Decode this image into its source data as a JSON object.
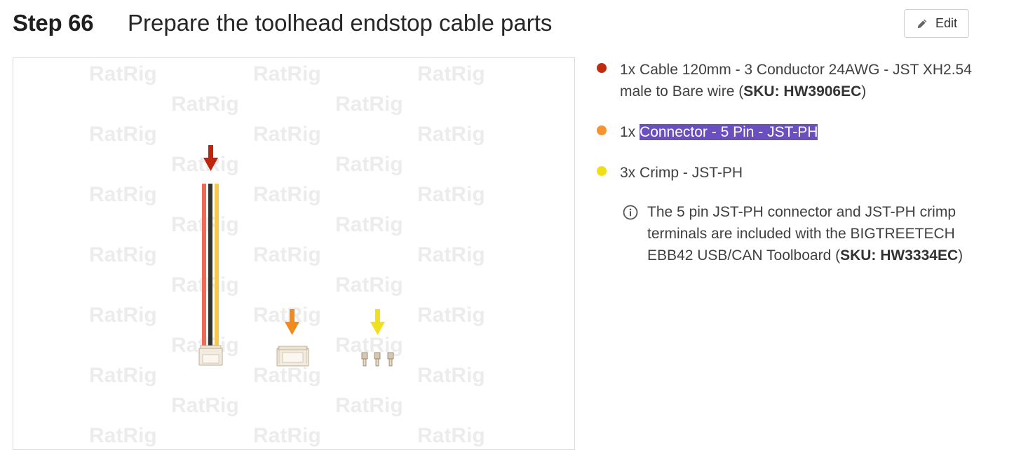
{
  "header": {
    "step_label": "Step 66",
    "title": "Prepare the toolhead endstop cable parts",
    "edit_label": "Edit"
  },
  "image": {
    "watermark": "RatRig",
    "arrow_colors": [
      "#c0240e",
      "#f28a1c",
      "#f0e020"
    ],
    "wire_colors": [
      "#ef6a55",
      "#333333",
      "#f8c84b"
    ]
  },
  "bullets": [
    {
      "color": "#c22a10",
      "qty": "1x",
      "text": "Cable 120mm - 3 Conductor 24AWG - JST XH2.54 male to Bare wire (",
      "sku": "SKU: HW3906EC",
      "suffix": ")"
    },
    {
      "color": "#f59430",
      "qty": "1x",
      "text": "Connector - 5 Pin - JST-PH"
    },
    {
      "color": "#f2dd19",
      "qty": "3x",
      "text": "Crimp - JST-PH"
    }
  ],
  "note": {
    "icon": "info-icon",
    "text": "The 5 pin JST-PH connector and JST-PH crimp terminals are included with the BIGTREETECH EBB42 USB/CAN Toolboard (",
    "sku": "SKU: HW3334EC",
    "suffix": ")"
  }
}
